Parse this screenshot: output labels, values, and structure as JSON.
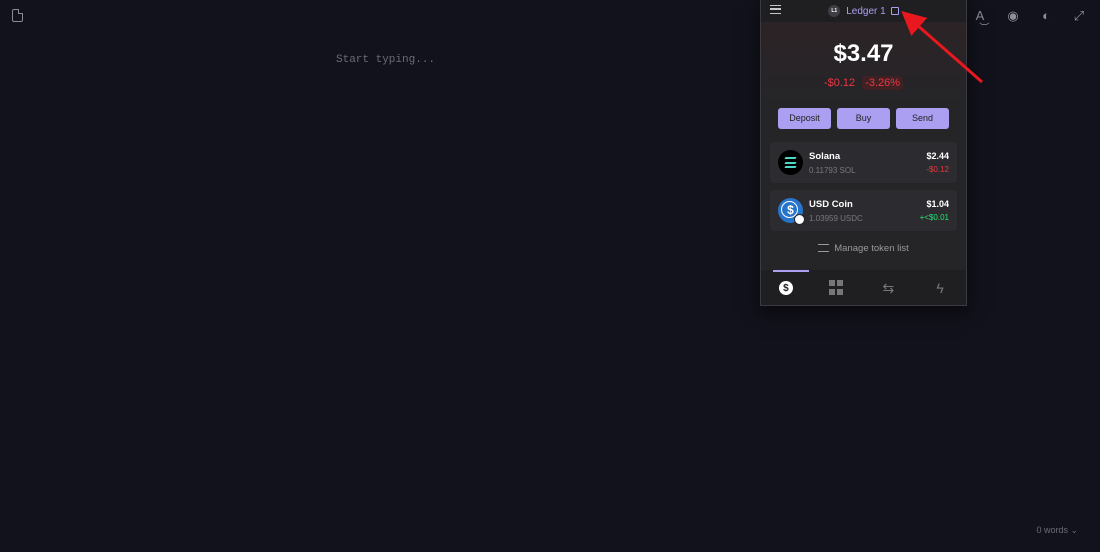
{
  "editor": {
    "placeholder": "Start typing...",
    "word_count": "0 words ⌄",
    "toolbar_icons": [
      "spellcheck-icon",
      "eye-icon",
      "contrast-icon",
      "expand-icon"
    ]
  },
  "wallet": {
    "account_badge": "L1",
    "account_name": "Ledger 1",
    "balance": "$3.47",
    "change_usd": "-$0.12",
    "change_pct": "-3.26%",
    "actions": [
      "Deposit",
      "Buy",
      "Send"
    ],
    "tokens": [
      {
        "name": "Solana",
        "amount": "0.11793 SOL",
        "usd": "$2.44",
        "change": "-$0.12"
      },
      {
        "name": "USD Coin",
        "amount": "1.03959 USDC",
        "usd": "$1.04",
        "change": "+<$0.01"
      }
    ],
    "manage_label": "Manage token list",
    "accent_color": "#ab9ff2",
    "negative_color": "#eb3742",
    "positive_color": "#21e56f"
  }
}
